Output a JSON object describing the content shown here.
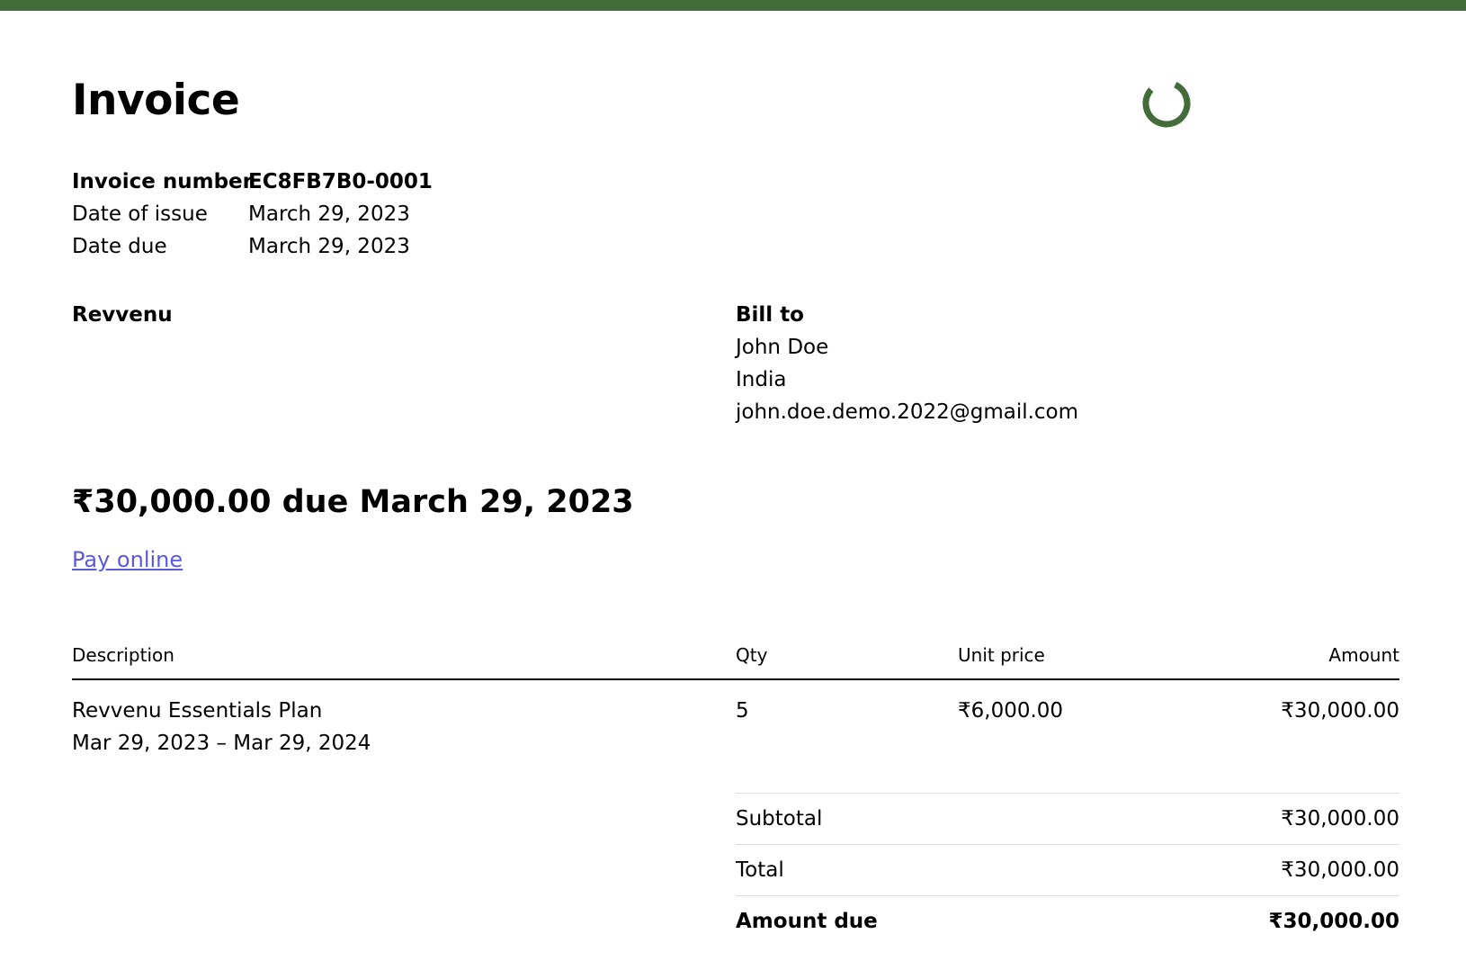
{
  "colors": {
    "top_bar": "#446b3a",
    "spinner": "#446b3a",
    "link": "#5a5ae0"
  },
  "icons": {
    "loading": "loading-spinner-icon"
  },
  "invoice": {
    "title": "Invoice",
    "meta": [
      {
        "label": "Invoice number",
        "value": "EC8FB7B0-0001"
      },
      {
        "label": "Date of issue",
        "value": "March 29, 2023"
      },
      {
        "label": "Date due",
        "value": "March 29, 2023"
      }
    ]
  },
  "seller": {
    "name": "Revvenu"
  },
  "bill_to": {
    "heading": "Bill to",
    "name": "John Doe",
    "country": "India",
    "email": "john.doe.demo.2022@gmail.com"
  },
  "due_summary": "₹30,000.00 due March 29, 2023",
  "pay_link": "Pay online",
  "line_items": {
    "headers": {
      "description": "Description",
      "qty": "Qty",
      "unit_price": "Unit price",
      "amount": "Amount"
    },
    "rows": [
      {
        "description": "Revvenu Essentials Plan",
        "period": "Mar 29, 2023 – Mar 29, 2024",
        "qty": "5",
        "unit_price": "₹6,000.00",
        "amount": "₹30,000.00"
      }
    ]
  },
  "totals": [
    {
      "label": "Subtotal",
      "value": "₹30,000.00"
    },
    {
      "label": "Total",
      "value": "₹30,000.00"
    },
    {
      "label": "Amount due",
      "value": "₹30,000.00"
    }
  ]
}
